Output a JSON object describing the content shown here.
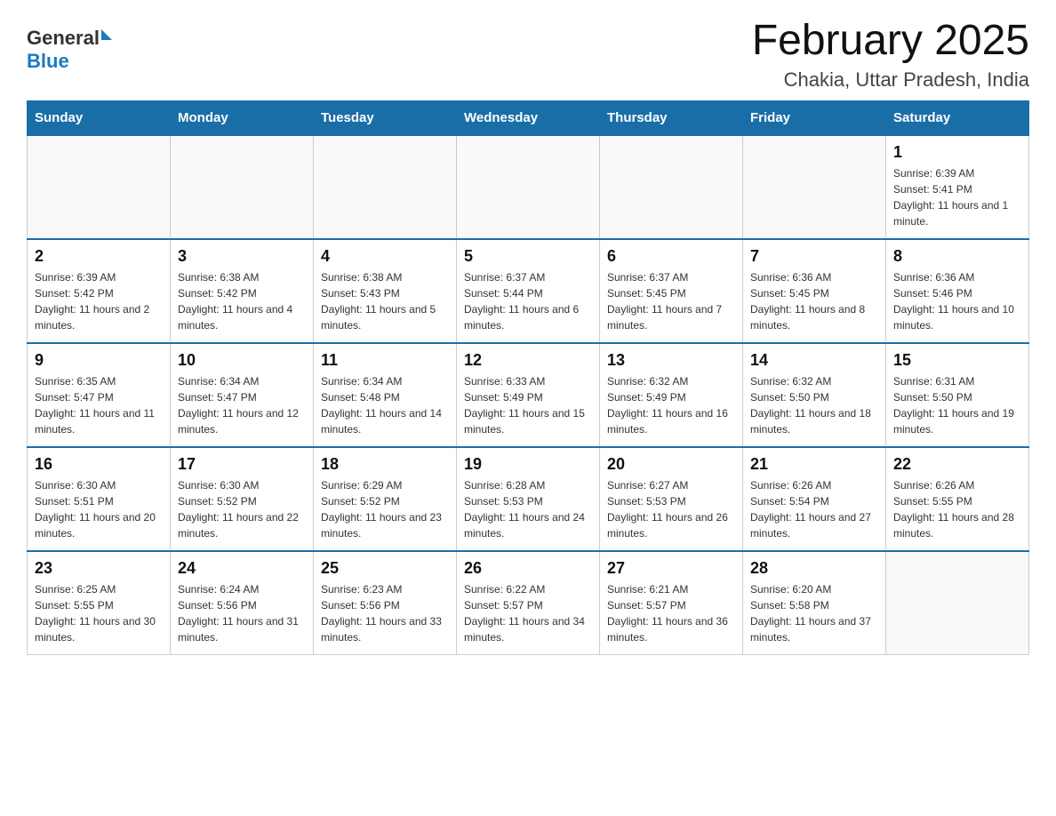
{
  "header": {
    "logo_general": "General",
    "logo_blue": "Blue",
    "month_title": "February 2025",
    "location": "Chakia, Uttar Pradesh, India"
  },
  "days_of_week": [
    "Sunday",
    "Monday",
    "Tuesday",
    "Wednesday",
    "Thursday",
    "Friday",
    "Saturday"
  ],
  "weeks": [
    [
      {
        "day": "",
        "info": ""
      },
      {
        "day": "",
        "info": ""
      },
      {
        "day": "",
        "info": ""
      },
      {
        "day": "",
        "info": ""
      },
      {
        "day": "",
        "info": ""
      },
      {
        "day": "",
        "info": ""
      },
      {
        "day": "1",
        "info": "Sunrise: 6:39 AM\nSunset: 5:41 PM\nDaylight: 11 hours and 1 minute."
      }
    ],
    [
      {
        "day": "2",
        "info": "Sunrise: 6:39 AM\nSunset: 5:42 PM\nDaylight: 11 hours and 2 minutes."
      },
      {
        "day": "3",
        "info": "Sunrise: 6:38 AM\nSunset: 5:42 PM\nDaylight: 11 hours and 4 minutes."
      },
      {
        "day": "4",
        "info": "Sunrise: 6:38 AM\nSunset: 5:43 PM\nDaylight: 11 hours and 5 minutes."
      },
      {
        "day": "5",
        "info": "Sunrise: 6:37 AM\nSunset: 5:44 PM\nDaylight: 11 hours and 6 minutes."
      },
      {
        "day": "6",
        "info": "Sunrise: 6:37 AM\nSunset: 5:45 PM\nDaylight: 11 hours and 7 minutes."
      },
      {
        "day": "7",
        "info": "Sunrise: 6:36 AM\nSunset: 5:45 PM\nDaylight: 11 hours and 8 minutes."
      },
      {
        "day": "8",
        "info": "Sunrise: 6:36 AM\nSunset: 5:46 PM\nDaylight: 11 hours and 10 minutes."
      }
    ],
    [
      {
        "day": "9",
        "info": "Sunrise: 6:35 AM\nSunset: 5:47 PM\nDaylight: 11 hours and 11 minutes."
      },
      {
        "day": "10",
        "info": "Sunrise: 6:34 AM\nSunset: 5:47 PM\nDaylight: 11 hours and 12 minutes."
      },
      {
        "day": "11",
        "info": "Sunrise: 6:34 AM\nSunset: 5:48 PM\nDaylight: 11 hours and 14 minutes."
      },
      {
        "day": "12",
        "info": "Sunrise: 6:33 AM\nSunset: 5:49 PM\nDaylight: 11 hours and 15 minutes."
      },
      {
        "day": "13",
        "info": "Sunrise: 6:32 AM\nSunset: 5:49 PM\nDaylight: 11 hours and 16 minutes."
      },
      {
        "day": "14",
        "info": "Sunrise: 6:32 AM\nSunset: 5:50 PM\nDaylight: 11 hours and 18 minutes."
      },
      {
        "day": "15",
        "info": "Sunrise: 6:31 AM\nSunset: 5:50 PM\nDaylight: 11 hours and 19 minutes."
      }
    ],
    [
      {
        "day": "16",
        "info": "Sunrise: 6:30 AM\nSunset: 5:51 PM\nDaylight: 11 hours and 20 minutes."
      },
      {
        "day": "17",
        "info": "Sunrise: 6:30 AM\nSunset: 5:52 PM\nDaylight: 11 hours and 22 minutes."
      },
      {
        "day": "18",
        "info": "Sunrise: 6:29 AM\nSunset: 5:52 PM\nDaylight: 11 hours and 23 minutes."
      },
      {
        "day": "19",
        "info": "Sunrise: 6:28 AM\nSunset: 5:53 PM\nDaylight: 11 hours and 24 minutes."
      },
      {
        "day": "20",
        "info": "Sunrise: 6:27 AM\nSunset: 5:53 PM\nDaylight: 11 hours and 26 minutes."
      },
      {
        "day": "21",
        "info": "Sunrise: 6:26 AM\nSunset: 5:54 PM\nDaylight: 11 hours and 27 minutes."
      },
      {
        "day": "22",
        "info": "Sunrise: 6:26 AM\nSunset: 5:55 PM\nDaylight: 11 hours and 28 minutes."
      }
    ],
    [
      {
        "day": "23",
        "info": "Sunrise: 6:25 AM\nSunset: 5:55 PM\nDaylight: 11 hours and 30 minutes."
      },
      {
        "day": "24",
        "info": "Sunrise: 6:24 AM\nSunset: 5:56 PM\nDaylight: 11 hours and 31 minutes."
      },
      {
        "day": "25",
        "info": "Sunrise: 6:23 AM\nSunset: 5:56 PM\nDaylight: 11 hours and 33 minutes."
      },
      {
        "day": "26",
        "info": "Sunrise: 6:22 AM\nSunset: 5:57 PM\nDaylight: 11 hours and 34 minutes."
      },
      {
        "day": "27",
        "info": "Sunrise: 6:21 AM\nSunset: 5:57 PM\nDaylight: 11 hours and 36 minutes."
      },
      {
        "day": "28",
        "info": "Sunrise: 6:20 AM\nSunset: 5:58 PM\nDaylight: 11 hours and 37 minutes."
      },
      {
        "day": "",
        "info": ""
      }
    ]
  ]
}
